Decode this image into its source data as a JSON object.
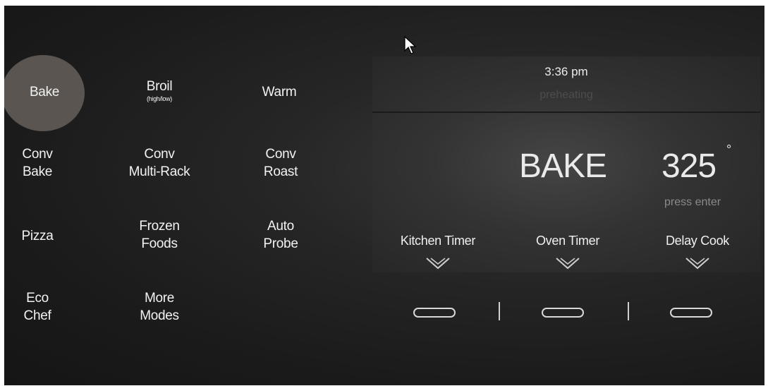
{
  "modes": {
    "bake": "Bake",
    "broil": "Broil",
    "broil_sub": "(high/low)",
    "warm": "Warm",
    "conv_bake": [
      "Conv",
      "Bake"
    ],
    "conv_multirack": [
      "Conv",
      "Multi-Rack"
    ],
    "conv_roast": [
      "Conv",
      "Roast"
    ],
    "pizza": "Pizza",
    "frozen_foods": [
      "Frozen",
      "Foods"
    ],
    "auto_probe": [
      "Auto",
      "Probe"
    ],
    "eco_chef": [
      "Eco",
      "Chef"
    ],
    "more_modes": [
      "More",
      "Modes"
    ]
  },
  "display": {
    "time": "3:36 pm",
    "status": "preheating",
    "mode": "BAKE",
    "temperature": "325",
    "degree_symbol": "°",
    "prompt": "press enter"
  },
  "timers": {
    "kitchen_timer": "Kitchen Timer",
    "oven_timer": "Oven Timer",
    "delay_cook": "Delay Cook"
  },
  "icons": {
    "chevron": "chevron-down-icon",
    "cursor": "mouse-pointer-icon",
    "slider": "pill-button"
  },
  "colors": {
    "selected_mode": "#5a5550",
    "text": "#f2f2f2",
    "dim_text": "#4d4d4d"
  }
}
